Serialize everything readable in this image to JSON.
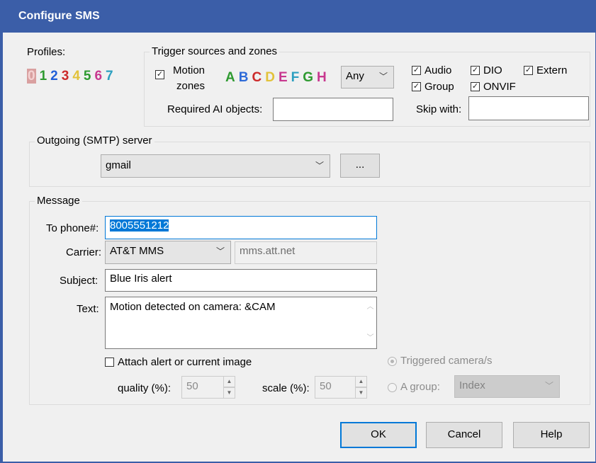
{
  "window": {
    "title": "Configure SMS"
  },
  "profiles": {
    "label": "Profiles:",
    "digits": [
      {
        "text": "0",
        "color": "#f0b5b5"
      },
      {
        "text": "1",
        "color": "#2e9a30"
      },
      {
        "text": "2",
        "color": "#1f5fd8"
      },
      {
        "text": "3",
        "color": "#cc2a2a"
      },
      {
        "text": "4",
        "color": "#e2c23a"
      },
      {
        "text": "5",
        "color": "#2e9a30"
      },
      {
        "text": "6",
        "color": "#c8388f"
      },
      {
        "text": "7",
        "color": "#2c9fc0"
      }
    ]
  },
  "trigger": {
    "group_label": "Trigger sources and zones",
    "motion_zones_line1": "Motion",
    "motion_zones_line2": "zones",
    "motion_checked": true,
    "zones": [
      {
        "text": "A",
        "color": "#2e9a30"
      },
      {
        "text": "B",
        "color": "#2e6bd8"
      },
      {
        "text": "C",
        "color": "#cc2a2a"
      },
      {
        "text": "D",
        "color": "#e2c23a"
      },
      {
        "text": "E",
        "color": "#c8388f"
      },
      {
        "text": "F",
        "color": "#2c9fc0"
      },
      {
        "text": "G",
        "color": "#2e9a30"
      },
      {
        "text": "H",
        "color": "#c8388f"
      }
    ],
    "zone_mode": "Any",
    "checkboxes": {
      "audio": "Audio",
      "dio": "DIO",
      "extern": "Extern",
      "group": "Group",
      "onvif": "ONVIF"
    },
    "required_ai_label": "Required AI objects:",
    "required_ai_value": "",
    "skip_with_label": "Skip with:",
    "skip_with_value": ""
  },
  "smtp": {
    "group_label": "Outgoing (SMTP) server",
    "server": "gmail",
    "more_button": "..."
  },
  "message": {
    "group_label": "Message",
    "to_label": "To phone#:",
    "to_value": "8005551212",
    "carrier_label": "Carrier:",
    "carrier_value": "AT&T MMS",
    "carrier_domain": "mms.att.net",
    "subject_label": "Subject:",
    "subject_value": "Blue Iris alert",
    "text_label": "Text:",
    "text_value": "Motion detected on camera: &CAM",
    "attach_label": "Attach alert or current image",
    "attach_checked": false,
    "quality_label": "quality (%):",
    "quality_value": "50",
    "scale_label": "scale (%):",
    "scale_value": "50",
    "triggered_label": "Triggered camera/s",
    "group_radio_label": "A group:",
    "group_select_value": "Index"
  },
  "buttons": {
    "ok": "OK",
    "cancel": "Cancel",
    "help": "Help"
  },
  "colors": {
    "titlebar": "#3b5ea8",
    "focus": "#0078d7",
    "selection": "#0078d7"
  }
}
